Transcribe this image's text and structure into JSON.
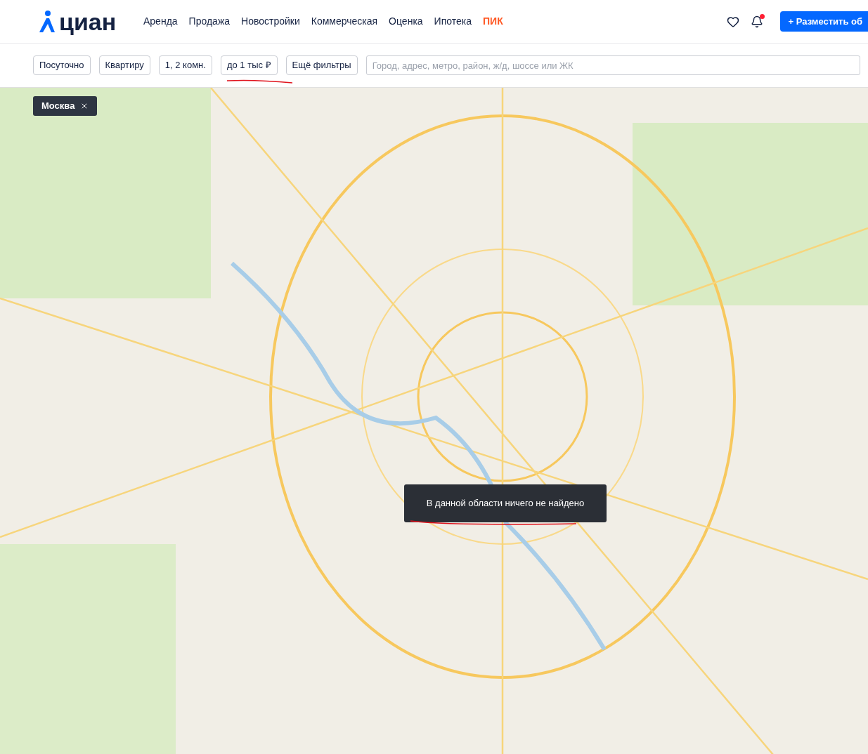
{
  "header": {
    "logo": "циан",
    "nav": [
      {
        "label": "Аренда",
        "kind": "plain"
      },
      {
        "label": "Продажа",
        "kind": "plain"
      },
      {
        "label": "Новостройки",
        "kind": "plain"
      },
      {
        "label": "Коммерческая",
        "kind": "plain"
      },
      {
        "label": "Оценка",
        "kind": "plain"
      },
      {
        "label": "Ипотека",
        "kind": "plain"
      },
      {
        "label": "ПИК",
        "kind": "brand"
      }
    ],
    "post_button": "+ Разместить об"
  },
  "filters": {
    "buttons": [
      "Посуточно",
      "Квартиру",
      "1, 2 комн.",
      "до 1 тыс ₽",
      "Ещё фильтры"
    ],
    "search": {
      "placeholder": "Город, адрес, метро, район, ж/д, шоссе или ЖК"
    }
  },
  "map": {
    "region_chip": "Москва",
    "notice": "В данной области ничего не найдено"
  }
}
